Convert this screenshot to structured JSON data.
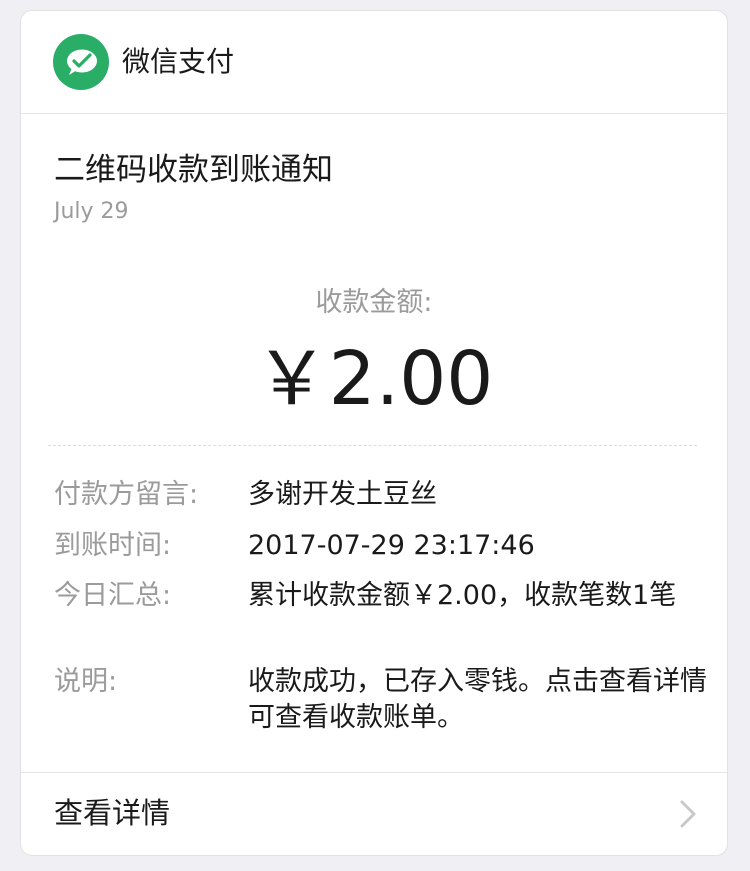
{
  "header": {
    "app_name": "微信支付",
    "logo_icon": "wechat-pay-icon",
    "brand_color": "#2aae67"
  },
  "notification": {
    "title": "二维码收款到账通知",
    "date": "July 29",
    "amount_label": "收款金额:",
    "amount": "￥2.00"
  },
  "details": [
    {
      "label": "付款方留言:",
      "value": "多谢开发土豆丝"
    },
    {
      "label": "到账时间:",
      "value": "2017-07-29 23:17:46"
    },
    {
      "label": "今日汇总:",
      "value": "累计收款金额￥2.00，收款笔数1笔"
    },
    {
      "label": "说明:",
      "value": "收款成功，已存入零钱。点击查看详情可查看收款账单。"
    }
  ],
  "footer": {
    "label": "查看详情",
    "icon": "chevron-right-icon"
  }
}
